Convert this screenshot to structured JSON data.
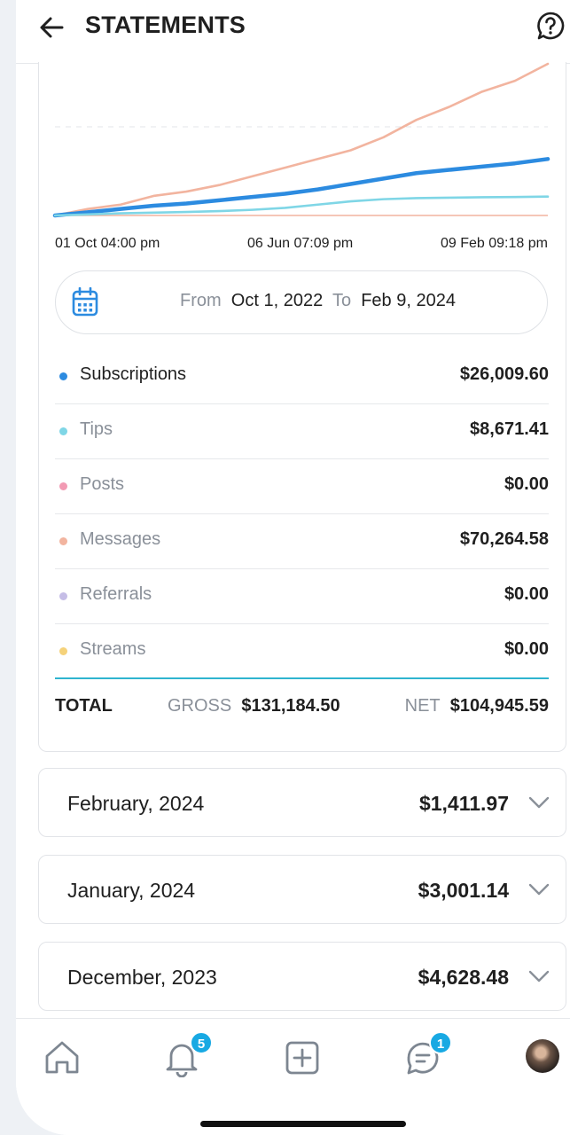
{
  "header": {
    "title": "STATEMENTS"
  },
  "chart_data": {
    "type": "line",
    "x_labels": [
      "01 Oct 04:00 pm",
      "06 Jun 07:09 pm",
      "09 Feb 09:18 pm"
    ],
    "series": [
      {
        "name": "Messages",
        "color": "#f2b49f",
        "values": [
          0,
          3,
          5,
          9,
          11,
          14,
          18,
          22,
          26,
          30,
          36,
          44,
          50,
          57,
          62,
          70
        ]
      },
      {
        "name": "Subscriptions",
        "color": "#2c8be0",
        "values": [
          0,
          1.5,
          3,
          4.5,
          5.5,
          7,
          8.5,
          10,
          12,
          14.5,
          17,
          19.5,
          21,
          22.5,
          24,
          26
        ]
      },
      {
        "name": "Tips",
        "color": "#7fd6e6",
        "values": [
          0,
          0.5,
          1,
          1.3,
          1.6,
          2,
          2.6,
          3.5,
          5,
          6.5,
          7.5,
          8,
          8.2,
          8.4,
          8.5,
          8.7
        ]
      }
    ]
  },
  "date_range": {
    "from_label": "From",
    "from": "Oct 1, 2022",
    "to_label": "To",
    "to": "Feb 9, 2024"
  },
  "breakdown": [
    {
      "label": "Subscriptions",
      "value": "$26,009.60",
      "color": "#2c8be0",
      "active": true
    },
    {
      "label": "Tips",
      "value": "$8,671.41",
      "color": "#7fd6e6",
      "active": false
    },
    {
      "label": "Posts",
      "value": "$0.00",
      "color": "#f29ab3",
      "active": false
    },
    {
      "label": "Messages",
      "value": "$70,264.58",
      "color": "#f2b49f",
      "active": false
    },
    {
      "label": "Referrals",
      "value": "$0.00",
      "color": "#c5bde6",
      "active": false
    },
    {
      "label": "Streams",
      "value": "$0.00",
      "color": "#f5d27a",
      "active": false
    }
  ],
  "totals": {
    "label": "TOTAL",
    "gross_label": "GROSS",
    "gross": "$131,184.50",
    "net_label": "NET",
    "net": "$104,945.59"
  },
  "months": [
    {
      "name": "February, 2024",
      "value": "$1,411.97"
    },
    {
      "name": "January, 2024",
      "value": "$3,001.14"
    },
    {
      "name": "December, 2023",
      "value": "$4,628.48"
    }
  ],
  "nav": {
    "notifications_badge": "5",
    "messages_badge": "1"
  }
}
